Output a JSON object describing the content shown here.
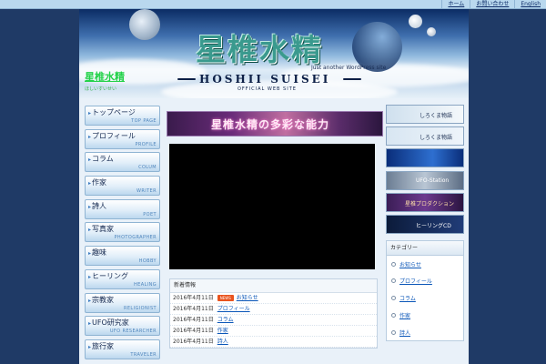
{
  "top_links": [
    "ホーム",
    "お問い合わせ",
    "English"
  ],
  "header": {
    "site_name": "星椎水精",
    "site_sub": "ほしいすいせい",
    "logo_jp": "星椎水精",
    "logo_en": "HOSHII SUISEI",
    "logo_sub": "OFFICIAL WEB SITE",
    "tagline": "Just another WordPress site"
  },
  "menu": [
    {
      "jp": "トップページ",
      "en": "TOP PAGE"
    },
    {
      "jp": "プロフィール",
      "en": "PROFILE"
    },
    {
      "jp": "コラム",
      "en": "COLUM"
    },
    {
      "jp": "作家",
      "en": "WRITER"
    },
    {
      "jp": "詩人",
      "en": "POET"
    },
    {
      "jp": "写真家",
      "en": "PHOTOGRAPHER"
    },
    {
      "jp": "趣味",
      "en": "HOBBY"
    },
    {
      "jp": "ヒーリング",
      "en": "HEALING"
    },
    {
      "jp": "宗教家",
      "en": "RELIGIONIST"
    },
    {
      "jp": "UFO研究家",
      "en": "UFO RESEARCHER"
    },
    {
      "jp": "旅行家",
      "en": "TRAVELER"
    }
  ],
  "center": {
    "ad_text": "星椎水精の多彩な能力",
    "news_title": "新着情報",
    "news": [
      {
        "date": "2016年4月11日",
        "badge": "NEWS",
        "title": "お知らせ"
      },
      {
        "date": "2016年4月11日",
        "badge": "",
        "title": "プロフィール"
      },
      {
        "date": "2016年4月11日",
        "badge": "",
        "title": "コラム"
      },
      {
        "date": "2016年4月11日",
        "badge": "",
        "title": "作家"
      },
      {
        "date": "2016年4月11日",
        "badge": "",
        "title": "詩人"
      }
    ]
  },
  "right": {
    "banners": [
      "しろくま物語",
      "しろくま物語",
      "",
      "UFO-Station",
      "星椎プロダクション",
      "ヒーリングCD"
    ],
    "category_title": "カテゴリー",
    "categories": [
      "お知らせ",
      "プロフィール",
      "コラム",
      "作家",
      "詩人"
    ]
  }
}
